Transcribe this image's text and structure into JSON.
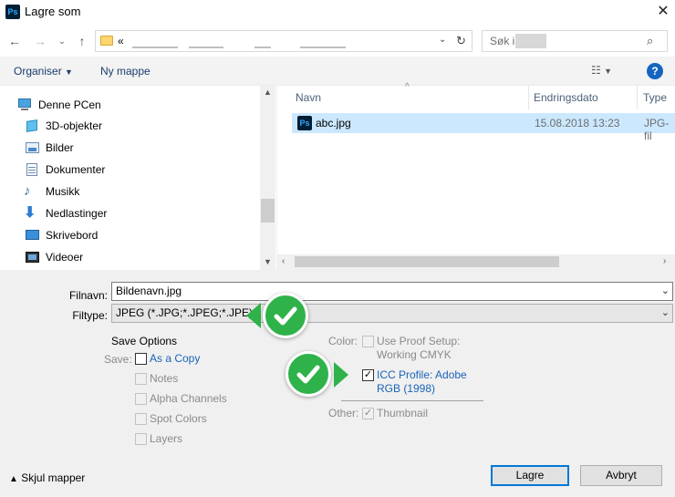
{
  "window": {
    "title": "Lagre som",
    "app_icon": "Ps"
  },
  "address": {
    "prefix": "«"
  },
  "search": {
    "placeholder": "Søk i"
  },
  "toolbar": {
    "organize": "Organiser",
    "new_folder": "Ny mappe"
  },
  "nav": {
    "items": [
      {
        "label": "Denne PCen",
        "icon": "computer-icon"
      },
      {
        "label": "3D-objekter",
        "icon": "cube-icon"
      },
      {
        "label": "Bilder",
        "icon": "pictures-icon"
      },
      {
        "label": "Dokumenter",
        "icon": "documents-icon"
      },
      {
        "label": "Musikk",
        "icon": "music-icon"
      },
      {
        "label": "Nedlastinger",
        "icon": "download-icon"
      },
      {
        "label": "Skrivebord",
        "icon": "desktop-icon"
      },
      {
        "label": "Videoer",
        "icon": "video-icon"
      }
    ]
  },
  "files": {
    "columns": {
      "name": "Navn",
      "date": "Endringsdato",
      "type": "Type"
    },
    "rows": [
      {
        "name": "abc.jpg",
        "date": "15.08.2018 13:23",
        "type": "JPG-fil"
      }
    ]
  },
  "form": {
    "filename_label": "Filnavn:",
    "filename_value": "Bildenavn.jpg",
    "filetype_label": "Filtype:",
    "filetype_value": "JPEG (*.JPG;*.JPEG;*.JPE)"
  },
  "save_options": {
    "title": "Save Options",
    "save_label": "Save:",
    "as_copy": "As a Copy",
    "notes": "Notes",
    "alpha": "Alpha Channels",
    "spot": "Spot Colors",
    "layers": "Layers"
  },
  "color": {
    "label": "Color:",
    "proof_line1": "Use Proof Setup:",
    "proof_line2": "Working CMYK",
    "icc_line1": "ICC Profile:  Adobe",
    "icc_line2": "RGB (1998)"
  },
  "other": {
    "label": "Other:",
    "thumbnail": "Thumbnail"
  },
  "footer": {
    "hide_folders": "Skjul mapper",
    "save": "Lagre",
    "cancel": "Avbryt"
  },
  "colors": {
    "accent": "#0078d7",
    "badge_green": "#2fb24a",
    "selection": "#cce8ff"
  }
}
